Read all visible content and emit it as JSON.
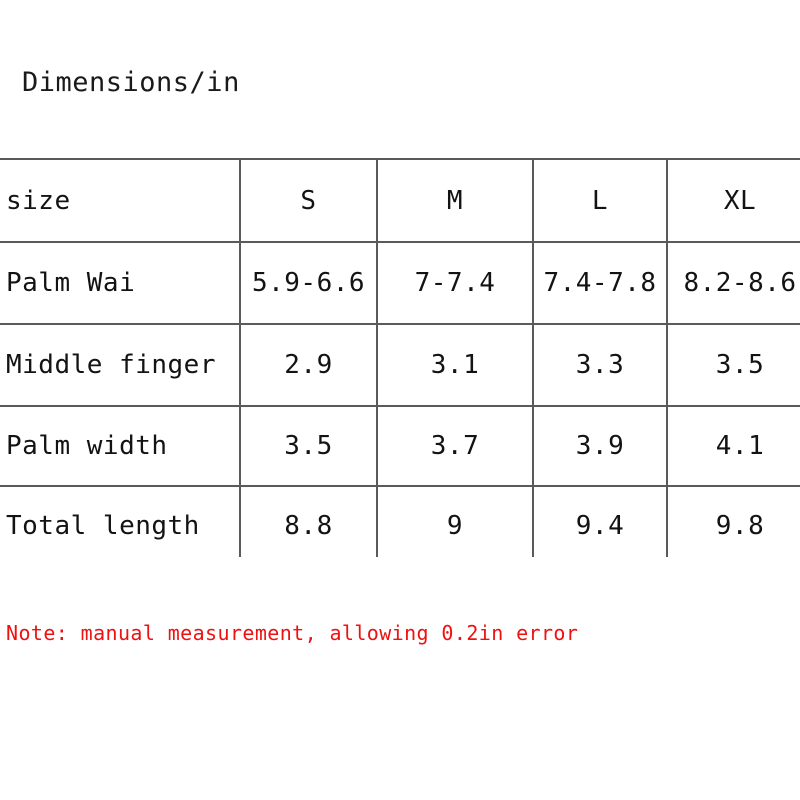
{
  "document": {
    "title": "Dimensions/in",
    "note": "Note: manual measurement, allowing 0.2in error",
    "note_color": "#ee1111",
    "border_color": "#5a5a5a",
    "text_color": "#131313",
    "background": "#ffffff"
  },
  "table": {
    "header": {
      "label": "size",
      "sizes": [
        "S",
        "M",
        "L",
        "XL"
      ]
    },
    "rows": [
      {
        "label": "Palm Wai",
        "values": [
          "5.9-6.6",
          "7-7.4",
          "7.4-7.8",
          "8.2-8.6"
        ]
      },
      {
        "label": "Middle finger",
        "values": [
          "2.9",
          "3.1",
          "3.3",
          "3.5"
        ]
      },
      {
        "label": "Palm width",
        "values": [
          "3.5",
          "3.7",
          "3.9",
          "4.1"
        ]
      },
      {
        "label": "Total length",
        "values": [
          "8.8",
          "9",
          "9.4",
          "9.8"
        ]
      }
    ]
  }
}
